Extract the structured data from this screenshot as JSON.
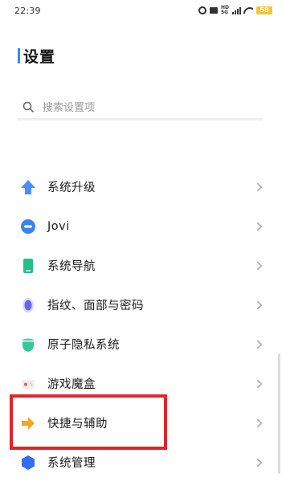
{
  "status_bar": {
    "time": "22:39",
    "battery": "58",
    "icons": [
      "alarm-icon",
      "mute-icon",
      "hd-icon",
      "signal-icon",
      "wifi-icon",
      "battery-icon"
    ]
  },
  "header": {
    "title": "设置"
  },
  "search": {
    "placeholder": "搜索设置项"
  },
  "menu": {
    "items": [
      {
        "label": "系统升级",
        "icon": "upgrade-arrow-icon",
        "color": "#4a8df5"
      },
      {
        "label": "Jovi",
        "icon": "jovi-icon",
        "color": "#3b82f0"
      },
      {
        "label": "系统导航",
        "icon": "phone-navigation-icon",
        "color": "#22c08a"
      },
      {
        "label": "指纹、面部与密码",
        "icon": "fingerprint-icon",
        "color": "#6a63e8"
      },
      {
        "label": "原子隐私系统",
        "icon": "privacy-shield-icon",
        "color": "#35c99a"
      },
      {
        "label": "游戏魔盒",
        "icon": "game-box-icon",
        "color": "#e85a5a"
      },
      {
        "label": "快捷与辅助",
        "icon": "shortcut-arrow-icon",
        "color": "#f6a524"
      },
      {
        "label": "系统管理",
        "icon": "system-management-icon",
        "color": "#2f6ff0"
      }
    ]
  },
  "highlight": {
    "target": "快捷与辅助",
    "color": "#e3232a"
  }
}
